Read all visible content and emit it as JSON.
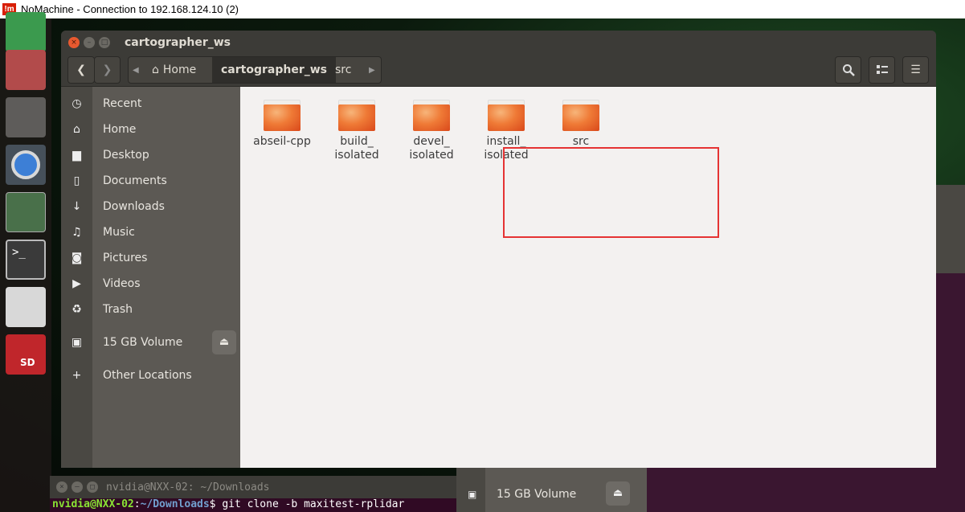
{
  "app": {
    "title": "NoMachine - Connection to 192.168.124.10 (2)",
    "logo": "!m"
  },
  "window": {
    "title": "cartographer_ws"
  },
  "path": [
    {
      "label": "Home",
      "icon": "home-icon"
    },
    {
      "label": "cartographer_ws"
    },
    {
      "label": "src"
    }
  ],
  "sidebar": {
    "items": [
      {
        "label": "Recent",
        "icon": "clock-icon",
        "glyph": "◷"
      },
      {
        "label": "Home",
        "icon": "home-icon",
        "glyph": "⌂"
      },
      {
        "label": "Desktop",
        "icon": "folder-icon",
        "glyph": "▆"
      },
      {
        "label": "Documents",
        "icon": "document-icon",
        "glyph": "▯"
      },
      {
        "label": "Downloads",
        "icon": "download-icon",
        "glyph": "↓"
      },
      {
        "label": "Music",
        "icon": "music-icon",
        "glyph": "♫"
      },
      {
        "label": "Pictures",
        "icon": "camera-icon",
        "glyph": "◙"
      },
      {
        "label": "Videos",
        "icon": "video-icon",
        "glyph": "▶"
      },
      {
        "label": "Trash",
        "icon": "trash-icon",
        "glyph": "♻"
      },
      {
        "label": "15 GB Volume",
        "icon": "drive-icon",
        "glyph": "▣"
      },
      {
        "label": "Other Locations",
        "icon": "plus-icon",
        "glyph": "+"
      }
    ]
  },
  "folders": [
    {
      "name": "abseil-cpp",
      "lines": [
        "abseil-cpp"
      ]
    },
    {
      "name": "build_isolated",
      "lines": [
        "build_",
        "isolated"
      ]
    },
    {
      "name": "devel_isolated",
      "lines": [
        "devel_",
        "isolated"
      ]
    },
    {
      "name": "install_isolated",
      "lines": [
        "install_",
        "isolated"
      ]
    },
    {
      "name": "src",
      "lines": [
        "src"
      ]
    }
  ],
  "terminal": {
    "title": "nvidia@NXX-02: ~/Downloads",
    "user": "nvidia@NXX-02",
    "path": "~/Downloads",
    "command": "$ git clone -b maxitest-rplidar"
  },
  "background_sidebar": {
    "label": "15 GB Volume"
  },
  "colors": {
    "highlight": "#e53333",
    "folder": "#ef7a36",
    "close": "#e8592f"
  }
}
